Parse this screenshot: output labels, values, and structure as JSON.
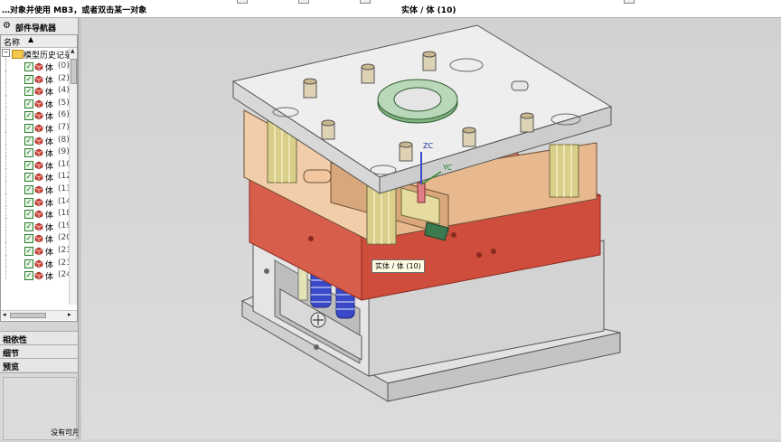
{
  "status_bar": {
    "prompt": "…对象并使用 MB3，或者双击某一对象",
    "selection_status": "实体 / 体 (10)"
  },
  "navigator": {
    "title": "部件导航器",
    "column_name": "名称",
    "history_label": "模型历史记录",
    "items": [
      {
        "label": "体",
        "num": "(0)"
      },
      {
        "label": "体",
        "num": "(2)"
      },
      {
        "label": "体",
        "num": "(4)"
      },
      {
        "label": "体",
        "num": "(5)"
      },
      {
        "label": "体",
        "num": "(6)"
      },
      {
        "label": "体",
        "num": "(7)"
      },
      {
        "label": "体",
        "num": "(8)"
      },
      {
        "label": "体",
        "num": "(9)"
      },
      {
        "label": "体",
        "num": "(10"
      },
      {
        "label": "体",
        "num": "(12"
      },
      {
        "label": "体",
        "num": "(13"
      },
      {
        "label": "体",
        "num": "(14"
      },
      {
        "label": "体",
        "num": "(18"
      },
      {
        "label": "体",
        "num": "(19"
      },
      {
        "label": "体",
        "num": "(20"
      },
      {
        "label": "体",
        "num": "(21"
      },
      {
        "label": "体",
        "num": "(23"
      },
      {
        "label": "体",
        "num": "(24"
      }
    ]
  },
  "panels": {
    "dependencies": "相依性",
    "details": "细节",
    "preview": "预览",
    "preview_message": "没有可月"
  },
  "viewport": {
    "tooltip": "实体 / 体 (10)",
    "axis_z": "ZC",
    "axis_y": "YC"
  },
  "colors": {
    "clamp_plate": "#e9e9e9",
    "a_plate": "#efc7a5",
    "selected_b_plate": "#d95a48",
    "support_block": "#d8d8d8",
    "spring": "#3a49c8",
    "guide_pillar": "#d9cf8a",
    "locating_ring": "#7fb07f"
  }
}
